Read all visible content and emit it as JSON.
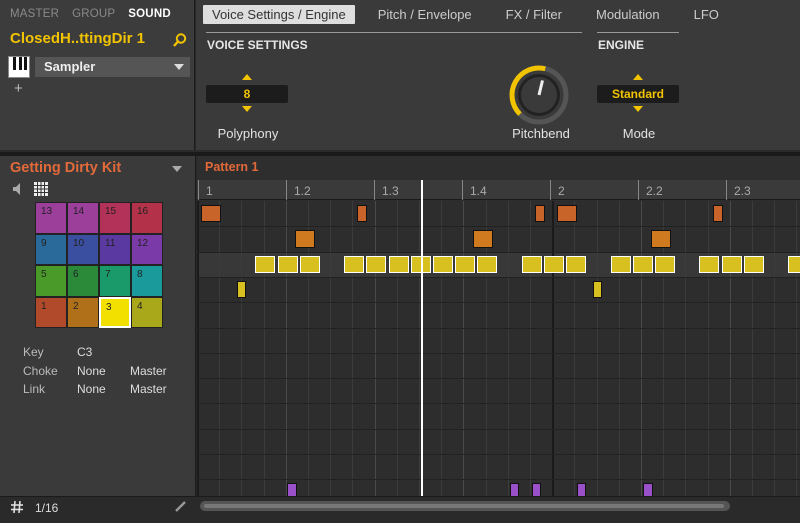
{
  "header": {
    "tabs": [
      "MASTER",
      "GROUP",
      "SOUND"
    ],
    "active_tab": 2,
    "sound_name": "ClosedH..ttingDir 1",
    "plugin": "Sampler",
    "add_label": "+"
  },
  "param_tabs": [
    "Voice Settings / Engine",
    "Pitch / Envelope",
    "FX / Filter",
    "Modulation",
    "LFO"
  ],
  "voice_settings": {
    "section_label": "VOICE SETTINGS",
    "polyphony_value": "8",
    "polyphony_label": "Polyphony",
    "pitchbend_label": "Pitchbend",
    "pitchbend_level": 0.55
  },
  "engine": {
    "section_label": "ENGINE",
    "mode_value": "Standard",
    "mode_label": "Mode"
  },
  "kit": {
    "name": "Getting Dirty Kit",
    "pads": [
      {
        "label": "13",
        "color": "#9b3f9b"
      },
      {
        "label": "14",
        "color": "#9b3f9b"
      },
      {
        "label": "15",
        "color": "#b3325a"
      },
      {
        "label": "16",
        "color": "#b3324a"
      },
      {
        "label": "9",
        "color": "#2a6a9a"
      },
      {
        "label": "10",
        "color": "#3a4fa0"
      },
      {
        "label": "11",
        "color": "#5a3aa0"
      },
      {
        "label": "12",
        "color": "#7a3aa8"
      },
      {
        "label": "5",
        "color": "#4a9a2a"
      },
      {
        "label": "6",
        "color": "#2a8a3a"
      },
      {
        "label": "7",
        "color": "#1a9a6a"
      },
      {
        "label": "8",
        "color": "#1a9a9a"
      },
      {
        "label": "1",
        "color": "#b04a2a"
      },
      {
        "label": "2",
        "color": "#b0701a"
      },
      {
        "label": "3",
        "color": "#f2e000"
      },
      {
        "label": "4",
        "color": "#a8a81a"
      }
    ],
    "selected_pad": 14,
    "info": {
      "key_label": "Key",
      "key_value": "C3",
      "choke_label": "Choke",
      "choke_value": "None",
      "choke_master": "Master",
      "link_label": "Link",
      "link_value": "None",
      "link_master": "Master"
    }
  },
  "pattern": {
    "name": "Pattern 1",
    "ruler_labels": [
      "1",
      "1.2",
      "1.3",
      "1.4",
      "2",
      "2.2",
      "2.3"
    ],
    "grid_label": "1/16"
  },
  "colors": {
    "accent": "#f2c400",
    "kit_orange": "#e26a3a",
    "note_orange": "#c8642a",
    "note_amber": "#d07a20",
    "note_yellow": "#d8c020",
    "note_purple": "#9a50c8"
  },
  "icons": {
    "search": "search-icon",
    "speaker": "speaker-icon",
    "grid": "grid-icon",
    "hash": "hash-icon",
    "pencil": "pencil-icon"
  }
}
